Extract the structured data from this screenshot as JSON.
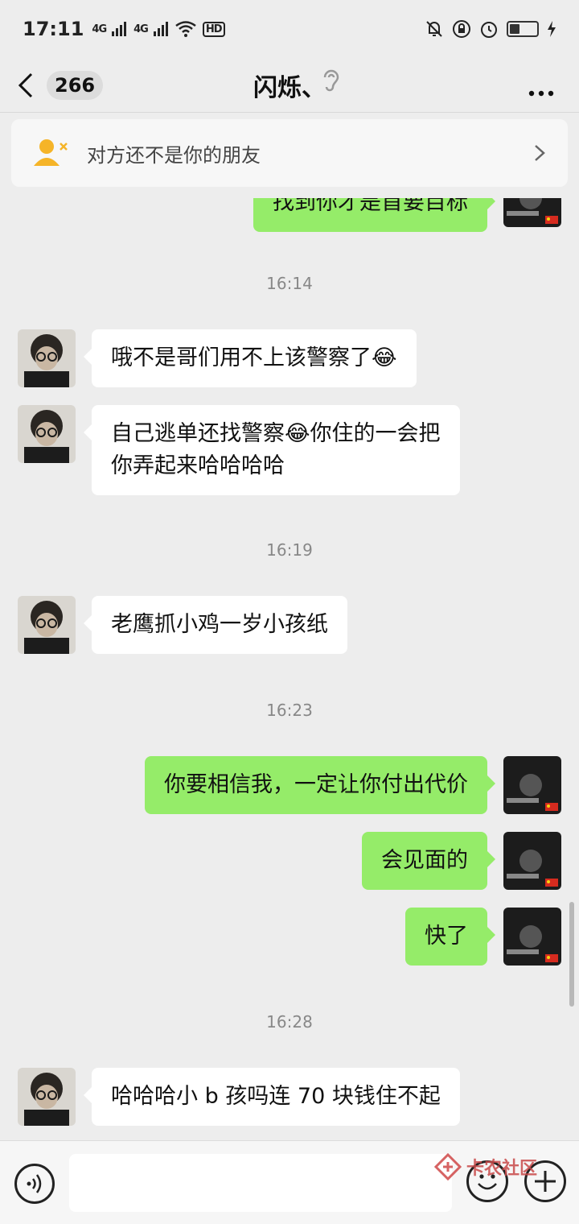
{
  "status_bar": {
    "time": "17:11",
    "signal1": "4G",
    "signal2": "4G",
    "hd": "HD"
  },
  "header": {
    "unread_count": "266",
    "title": "闪烁、"
  },
  "banner": {
    "text": "对方还不是你的朋友"
  },
  "messages": {
    "partial_top": "找到你才是首要目标",
    "t1": "16:14",
    "m1": "哦不是哥们用不上该警察了😂",
    "m2_line1": "自己逃单还找警察😂你住的一会把",
    "m2_line2": "你弄起来哈哈哈哈",
    "t2": "16:19",
    "m3": "老鹰抓小鸡一岁小孩纸",
    "t3": "16:23",
    "m4": "你要相信我，一定让你付出代价",
    "m5": "会见面的",
    "m6": "快了",
    "t4": "16:28",
    "m7": "哈哈哈小 b 孩吗连 70 块钱住不起"
  },
  "watermark": {
    "text": "卡农社区"
  },
  "colors": {
    "background": "#ededed",
    "outgoing_bubble": "#95ec69",
    "incoming_bubble": "#ffffff"
  }
}
